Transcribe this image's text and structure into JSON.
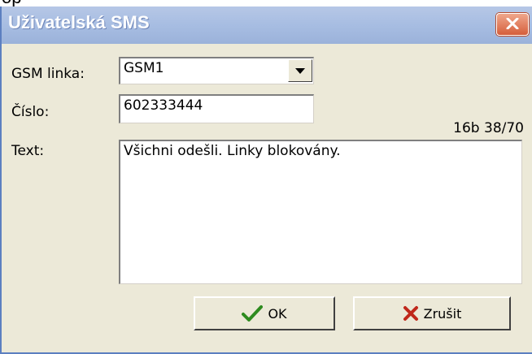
{
  "window": {
    "title": "Uživatelská SMS"
  },
  "form": {
    "gsm_label": "GSM linka:",
    "gsm_value": "GSM1",
    "number_label": "Číslo:",
    "number_value": "602333444",
    "text_label": "Text:",
    "text_value": "Všichni odešli. Linky blokovány.",
    "counter": "16b 38/70"
  },
  "buttons": {
    "ok_label": "OK",
    "cancel_label": "Zrušit"
  },
  "icons": {
    "close": "close-icon",
    "ok": "checkmark-icon",
    "cancel": "x-icon",
    "dropdown": "chevron-down-icon"
  },
  "colors": {
    "titlebar": "#a7bde2",
    "close_button": "#d55e3b",
    "dialog_bg": "#ece9d8",
    "check_green": "#2e8b1f",
    "cross_red": "#c0281b"
  }
}
